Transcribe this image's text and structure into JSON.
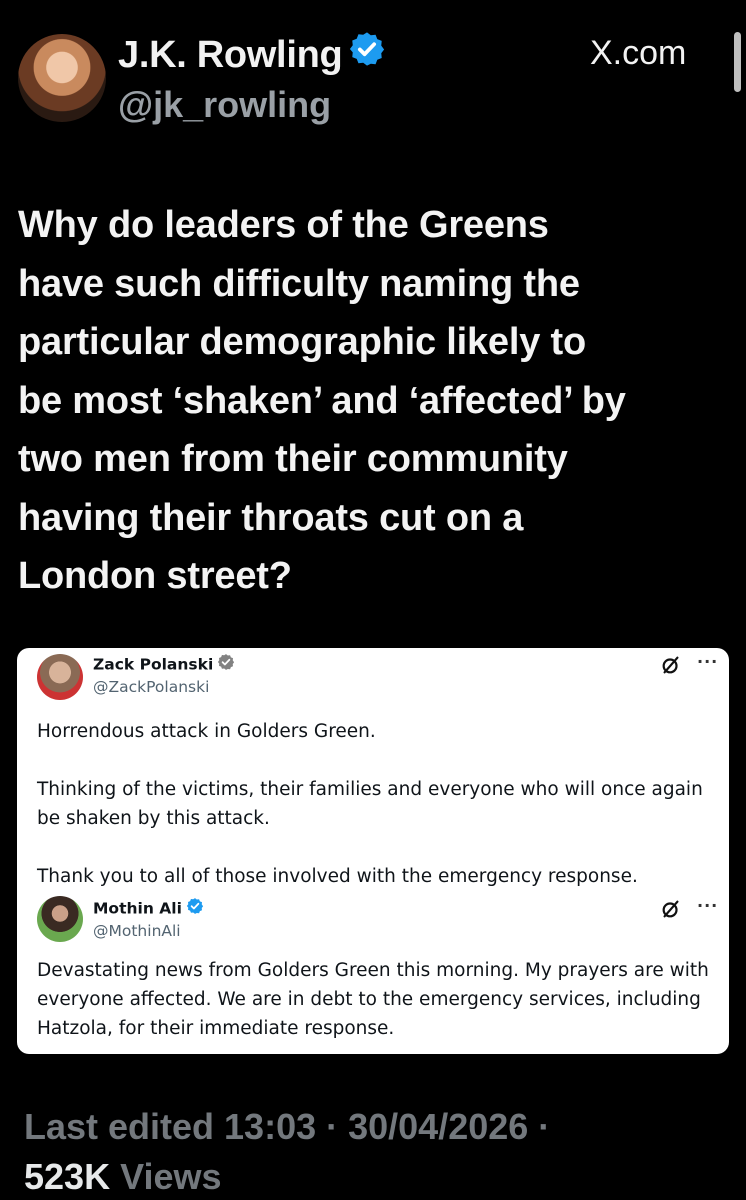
{
  "author": {
    "display_name": "J.K. Rowling",
    "handle": "@jk_rowling",
    "verified_color": "#1d9bf0"
  },
  "brand": "X.com",
  "tweet": {
    "lines": [
      "Why do leaders of the Greens",
      "have such difficulty naming the",
      "particular demographic likely to",
      "be most ‘shaken’ and ‘affected’ by",
      "two men from their community",
      "having their throats cut on a",
      "London street?"
    ]
  },
  "quoted_posts": [
    {
      "name": "Zack Polanski",
      "handle": "@ZackPolanski",
      "more": "···",
      "paragraphs": [
        "Horrendous attack in Golders Green.",
        "Thinking of the victims, their families and everyone who will once again be shaken by this attack.",
        "Thank you to all of those involved with the emergency response."
      ]
    },
    {
      "name": "Mothin Ali",
      "handle": "@MothinAli",
      "more": "···",
      "paragraphs": [
        "Devastating news from Golders Green this morning. My prayers are with everyone affected. We are in debt to the emergency services, including Hatzola, for their immediate response."
      ]
    }
  ],
  "footer": {
    "edited": "Last edited 13:03 · 30/04/2026 ·",
    "views_count": "523K",
    "views_label": "Views"
  }
}
